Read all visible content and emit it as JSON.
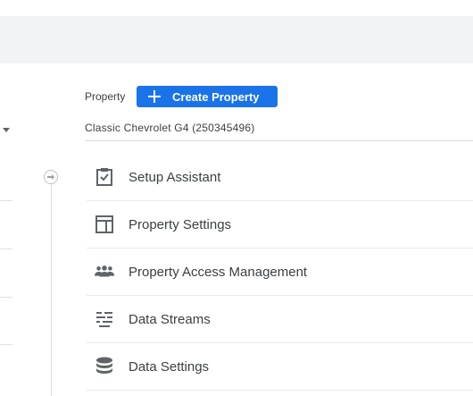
{
  "property": {
    "label": "Property",
    "create_button": "Create Property",
    "name": "Classic Chevrolet G4 (250345496)"
  },
  "menu": {
    "items": [
      {
        "label": "Setup Assistant",
        "icon": "clipboard-check-icon"
      },
      {
        "label": "Property Settings",
        "icon": "layout-icon"
      },
      {
        "label": "Property Access Management",
        "icon": "people-icon"
      },
      {
        "label": "Data Streams",
        "icon": "data-streams-icon"
      },
      {
        "label": "Data Settings",
        "icon": "database-icon"
      }
    ]
  },
  "colors": {
    "accent": "#1a73e8",
    "topbar": "#f1f3f4",
    "icon": "#5f6368"
  }
}
